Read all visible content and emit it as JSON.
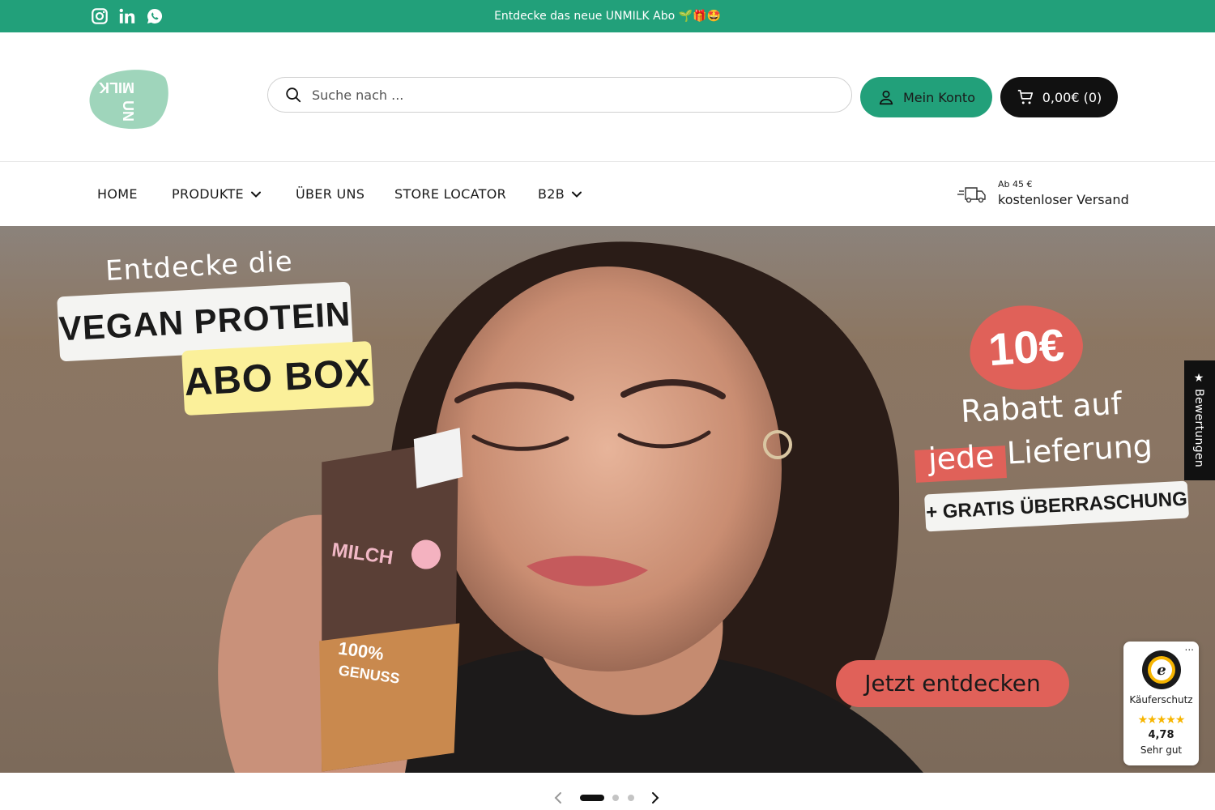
{
  "announcement": {
    "text": "Entdecke das neue UNMILK Abo 🌱🎁🤩",
    "social": [
      "instagram-icon",
      "linkedin-icon",
      "whatsapp-icon"
    ]
  },
  "header": {
    "logo_text": "UN MILK",
    "search_placeholder": "Suche nach ...",
    "account_label": "Mein Konto",
    "cart_label": "0,00€ (0)"
  },
  "nav": {
    "items": [
      {
        "label": "HOME",
        "dropdown": false
      },
      {
        "label": "PRODUKTE",
        "dropdown": true
      },
      {
        "label": "ÜBER UNS",
        "dropdown": false
      },
      {
        "label": "STORE LOCATOR",
        "dropdown": false
      },
      {
        "label": "B2B",
        "dropdown": true
      }
    ],
    "shipping_small": "Ab 45 €",
    "shipping_big": "kostenloser Versand"
  },
  "hero": {
    "line1": "Entdecke die",
    "line2": "VEGAN PROTEIN",
    "line3": "ABO BOX",
    "badge": "10€",
    "rabatt": "Rabatt auf",
    "jede": "jede",
    "lieferung": "Lieferung",
    "gratis": "+ GRATIS ÜBERRASCHUNG",
    "cta": "Jetzt entdecken",
    "pack_text_1": "MILCH",
    "pack_text_2": "100%",
    "pack_text_3": "GENUSS"
  },
  "reviews_tab": "★ Bewertungen",
  "trusted_shops": {
    "label": "Käuferschutz",
    "stars": "★★★★★",
    "score": "4,78",
    "rating_text": "Sehr gut",
    "menu": "..."
  },
  "slider": {
    "slides": 3,
    "active": 1
  },
  "colors": {
    "brand_green": "#22a07a",
    "accent_red": "#e06159",
    "label_yellow": "#fbf09a",
    "dark": "#111111"
  }
}
